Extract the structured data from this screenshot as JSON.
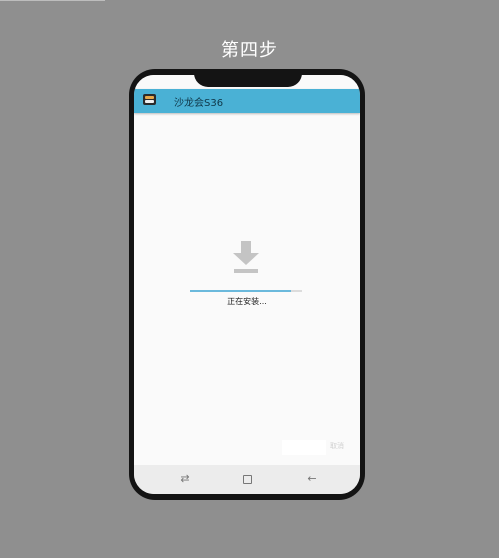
{
  "page": {
    "step_title": "第四步"
  },
  "app": {
    "title": "沙龙会S36"
  },
  "install": {
    "status_text": "正在安装...",
    "progress_percent": 90,
    "cancel_label": "取消"
  },
  "colors": {
    "background": "#8f8f8f",
    "appbar": "#4ab1d5",
    "progress": "#6bb9dc"
  },
  "icons": {
    "download": "download-icon",
    "recent": "recent-apps-icon",
    "home": "home-icon",
    "back": "back-icon"
  }
}
